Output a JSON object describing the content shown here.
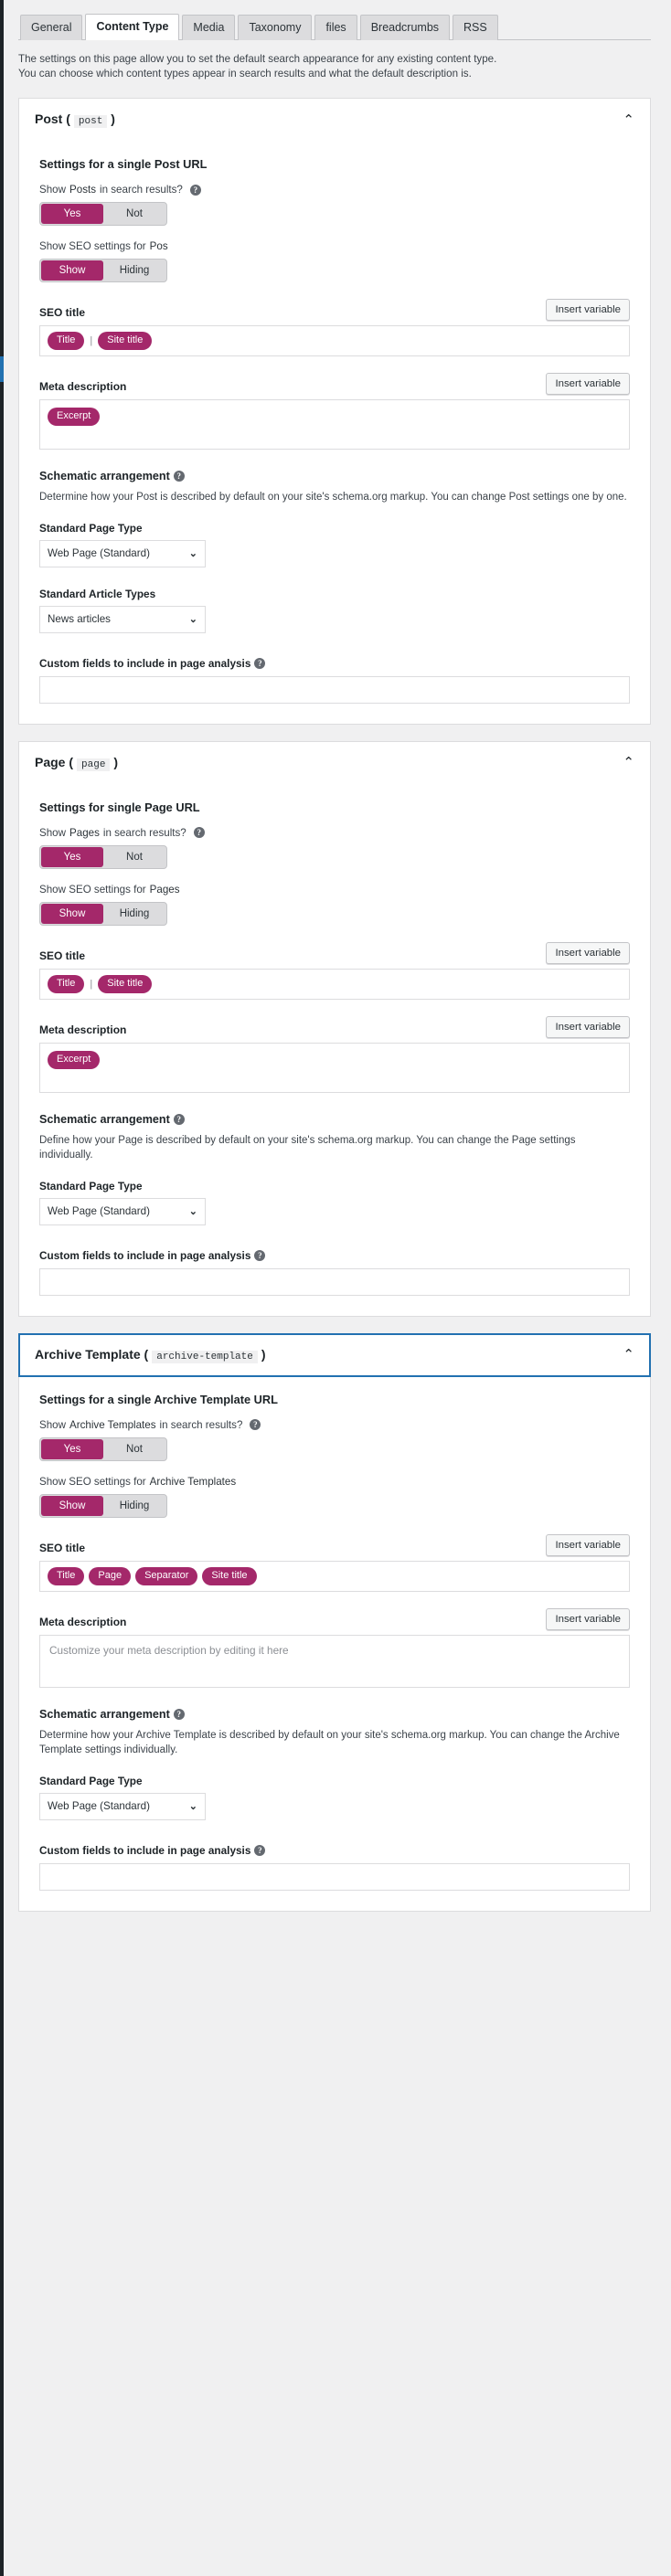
{
  "tabs": [
    {
      "label": "General",
      "active": false
    },
    {
      "label": "Content Type",
      "active": true
    },
    {
      "label": "Media",
      "active": false
    },
    {
      "label": "Taxonomy",
      "active": false
    },
    {
      "label": "files",
      "active": false
    },
    {
      "label": "Breadcrumbs",
      "active": false
    },
    {
      "label": "RSS",
      "active": false
    }
  ],
  "intro": {
    "line1": "The settings on this page allow you to set the default search appearance for any existing content type.",
    "line2": "You can choose which content types appear in search results and what the default description is."
  },
  "common": {
    "insert_variable": "Insert variable",
    "seo_title_label": "SEO title",
    "meta_description_label": "Meta description",
    "schematic_label": "Schematic arrangement",
    "standard_page_type_label": "Standard Page Type",
    "standard_article_types_label": "Standard Article Types",
    "custom_fields_label": "Custom fields to include in page analysis",
    "help_glyph": "?",
    "caret_up": "⌃",
    "separator_glyph": "|",
    "chevron_down": "⌄",
    "toggle_yes": "Yes",
    "toggle_not": "Not",
    "toggle_show": "Show",
    "toggle_hiding": "Hiding",
    "accent_color": "#a4286a",
    "focus_color": "#2271b1"
  },
  "panels": [
    {
      "id": "post",
      "title": "Post (",
      "slug": "post",
      "title_close": ")",
      "focused": false,
      "settings_heading": "Settings for a single Post URL",
      "search_results_prefix": "Show",
      "search_results_strong": "Posts",
      "search_results_suffix": "in search results?",
      "search_results_value": "Yes",
      "seo_settings_prefix": "Show SEO settings for",
      "seo_settings_strong": "Pos",
      "seo_settings_value": "Show",
      "seo_title_pills": [
        "Title",
        "Site title"
      ],
      "seo_title_separated": true,
      "meta_description_pills": [
        "Excerpt"
      ],
      "meta_description_placeholder": "",
      "schematic_desc": "Determine how your Post is described by default on your site's schema.org markup. You can change Post settings one by one.",
      "standard_page_type": "Web Page (Standard)",
      "standard_article_types": "News articles",
      "has_article_types": true,
      "custom_fields_value": ""
    },
    {
      "id": "page",
      "title": "Page (",
      "slug": "page",
      "title_close": ")",
      "focused": false,
      "settings_heading": "Settings for single Page URL",
      "search_results_prefix": "Show",
      "search_results_strong": "Pages",
      "search_results_suffix": "in search results?",
      "search_results_value": "Yes",
      "seo_settings_prefix": "Show SEO settings for",
      "seo_settings_strong": "Pages",
      "seo_settings_value": "Show",
      "seo_title_pills": [
        "Title",
        "Site title"
      ],
      "seo_title_separated": true,
      "meta_description_pills": [
        "Excerpt"
      ],
      "meta_description_placeholder": "",
      "schematic_desc": "Define how your Page is described by default on your site's schema.org markup. You can change the Page settings individually.",
      "standard_page_type": "Web Page (Standard)",
      "standard_article_types": "",
      "has_article_types": false,
      "custom_fields_value": ""
    },
    {
      "id": "archive-template",
      "title": "Archive Template (",
      "slug": "archive-template",
      "title_close": ")",
      "focused": true,
      "settings_heading": "Settings for a single Archive Template URL",
      "search_results_prefix": "Show",
      "search_results_strong": "Archive Templates",
      "search_results_suffix": "in search results?",
      "search_results_value": "Yes",
      "seo_settings_prefix": "Show SEO settings for",
      "seo_settings_strong": "Archive Templates",
      "seo_settings_value": "Show",
      "seo_title_pills": [
        "Title",
        "Page",
        "Separator",
        "Site title"
      ],
      "seo_title_separated": false,
      "meta_description_pills": [],
      "meta_description_placeholder": "Customize your meta description by editing it here",
      "schematic_desc": "Determine how your Archive Template is described by default on your site's schema.org markup. You can change the Archive Template settings individually.",
      "standard_page_type": "Web Page (Standard)",
      "standard_article_types": "",
      "has_article_types": false,
      "custom_fields_value": ""
    }
  ]
}
